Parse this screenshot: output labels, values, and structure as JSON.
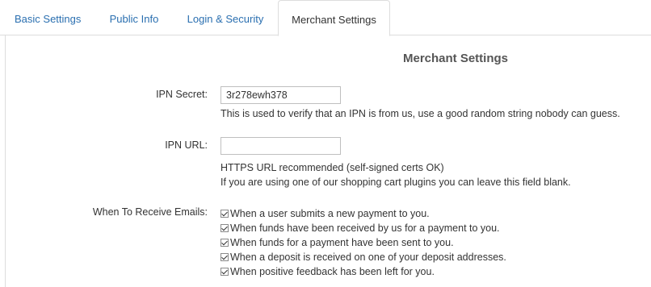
{
  "tabs": [
    {
      "label": "Basic Settings"
    },
    {
      "label": "Public Info"
    },
    {
      "label": "Login & Security"
    },
    {
      "label": "Merchant Settings",
      "active": true
    }
  ],
  "section_title": "Merchant Settings",
  "ipn_secret": {
    "label": "IPN Secret:",
    "value": "3r278ewh378",
    "help": "This is used to verify that an IPN is from us, use a good random string nobody can guess."
  },
  "ipn_url": {
    "label": "IPN URL:",
    "value": "",
    "help_lines": [
      "HTTPS URL recommended (self-signed certs OK)",
      "If you are using one of our shopping cart plugins you can leave this field blank."
    ]
  },
  "emails": {
    "label": "When To Receive Emails:",
    "options": [
      {
        "label": "When a user submits a new payment to you.",
        "checked": true
      },
      {
        "label": "When funds have been received by us for a payment to you.",
        "checked": true
      },
      {
        "label": "When funds for a payment have been sent to you.",
        "checked": true
      },
      {
        "label": "When a deposit is received on one of your deposit addresses.",
        "checked": true
      },
      {
        "label": "When positive feedback has been left for you.",
        "checked": true
      }
    ]
  },
  "colors": {
    "link": "#2a6fb0",
    "border": "#dddddd",
    "text": "#333333"
  }
}
